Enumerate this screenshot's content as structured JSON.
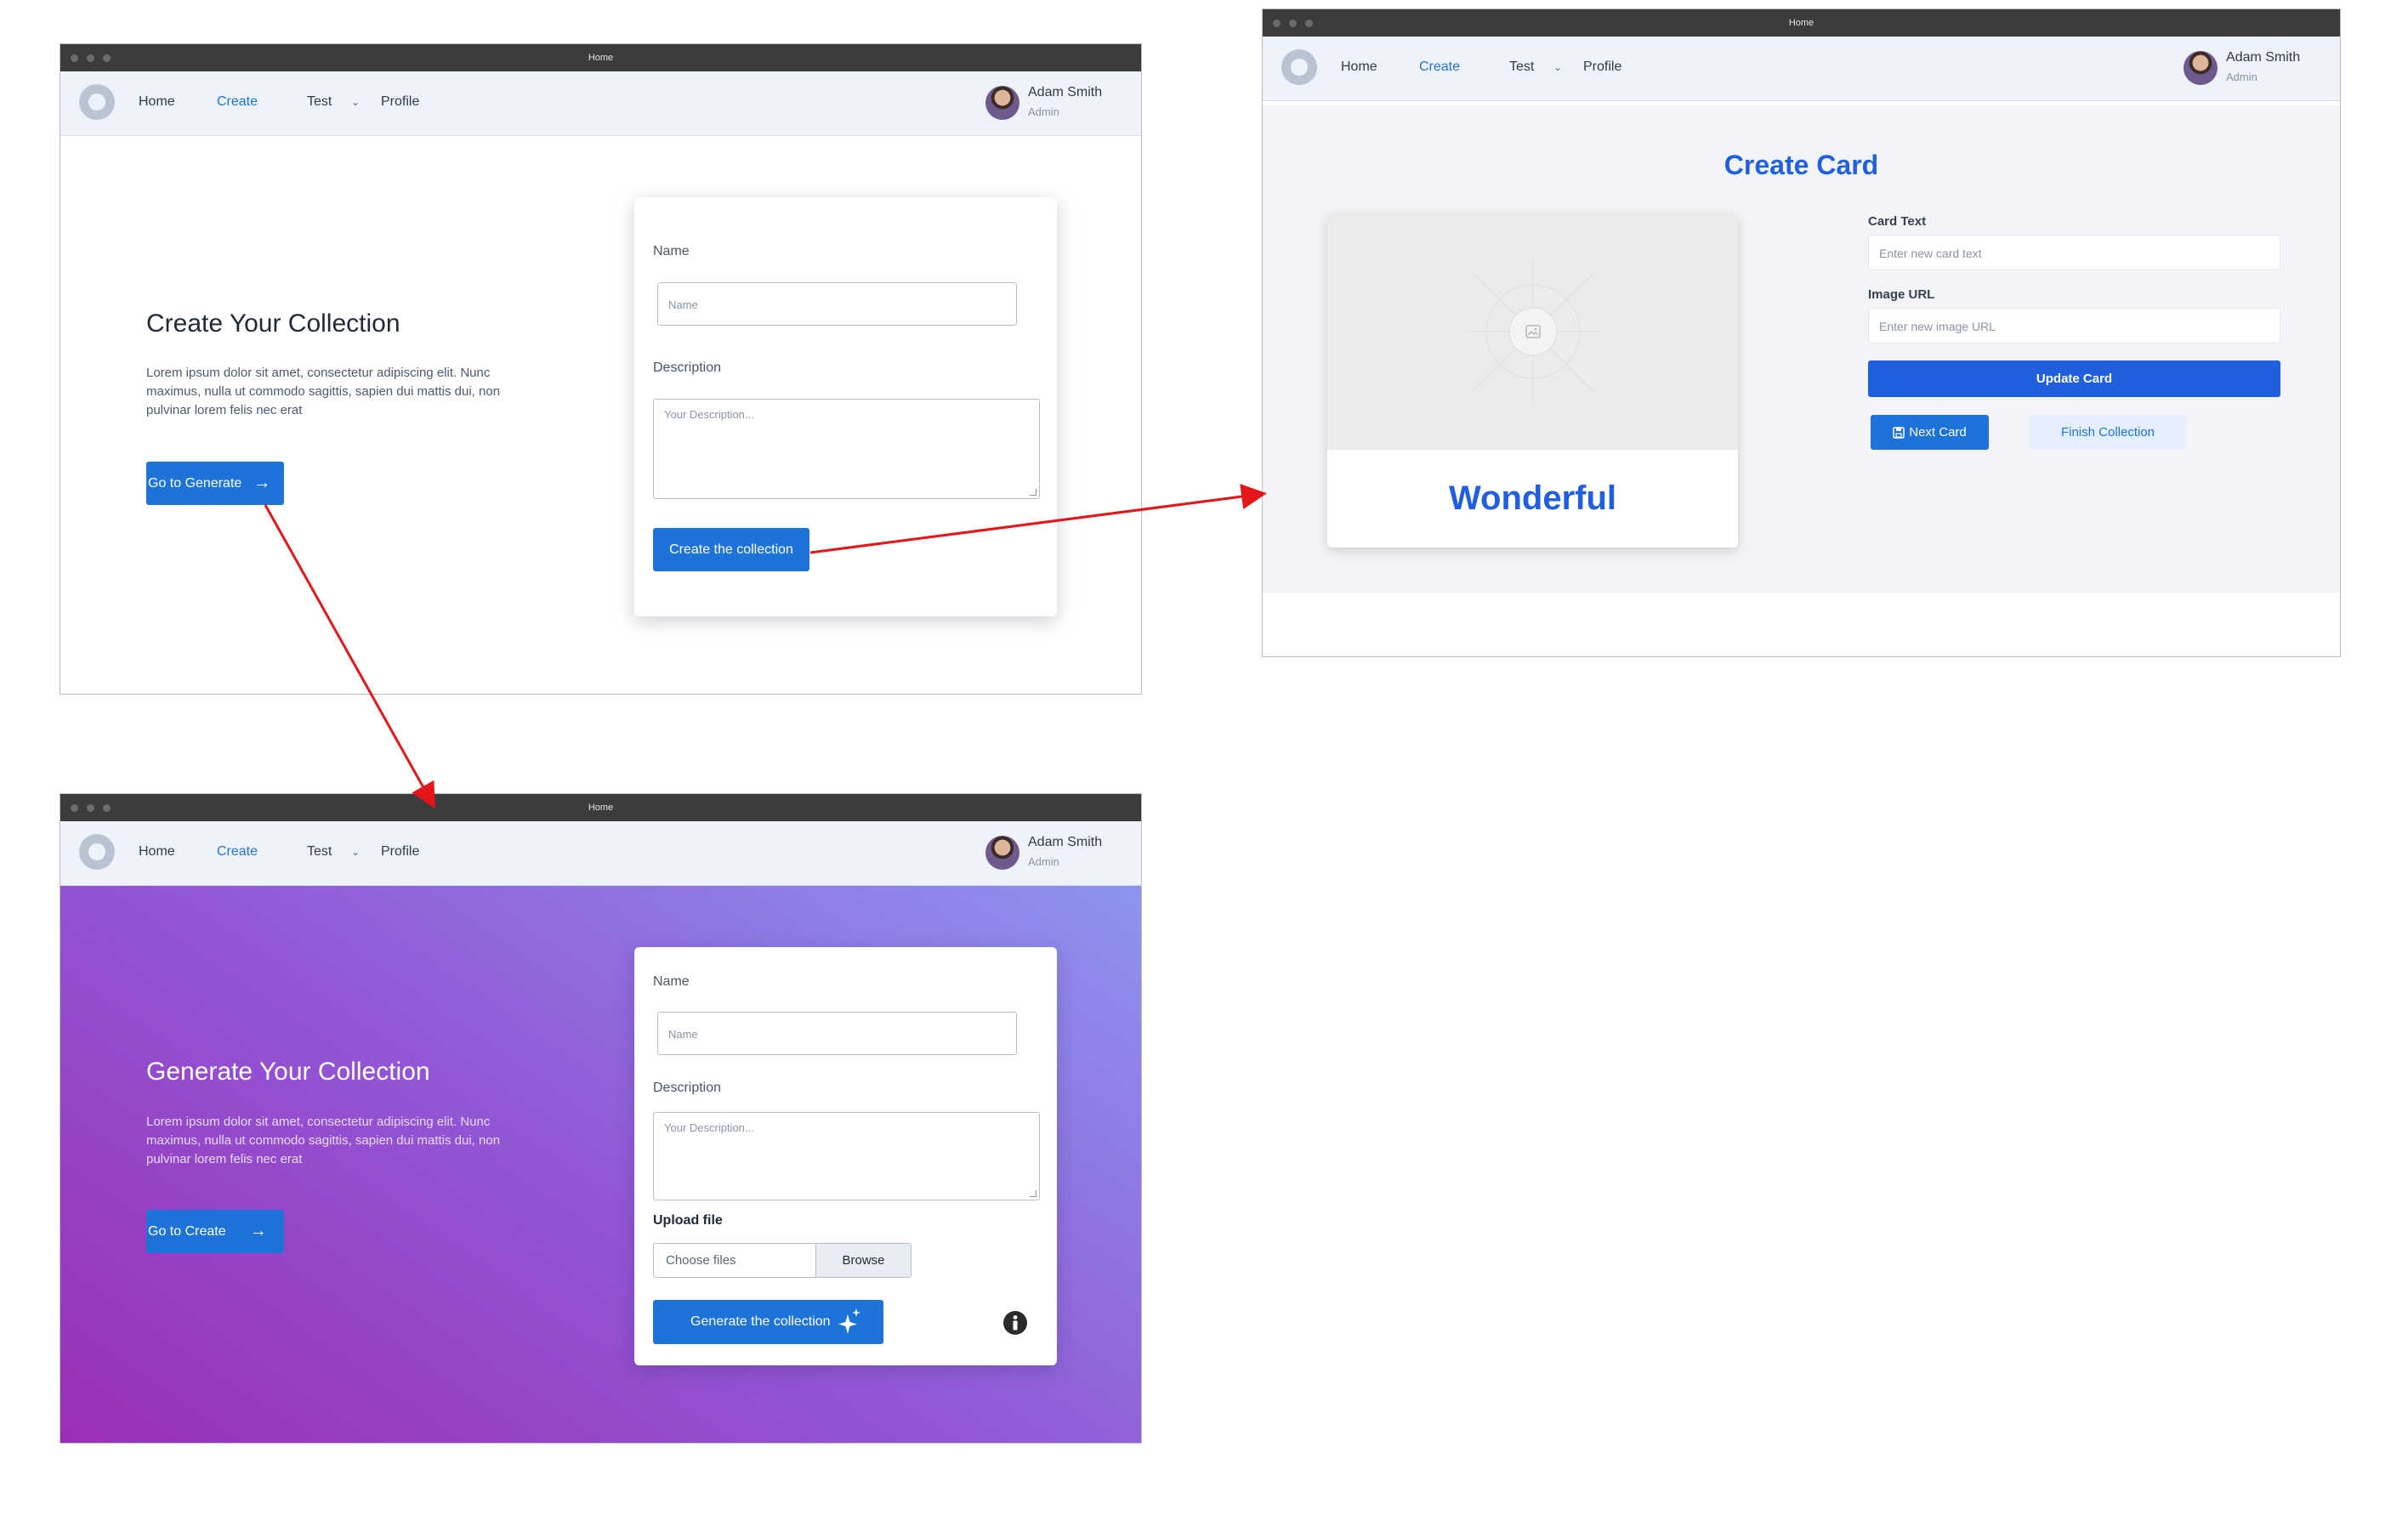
{
  "windows": {
    "create": {
      "title": "Home"
    },
    "generate": {
      "title": "Home"
    },
    "card": {
      "title": "Home"
    }
  },
  "nav": {
    "home": "Home",
    "create": "Create",
    "test": "Test",
    "profile": "Profile",
    "user_name": "Adam Smith",
    "user_role": "Admin"
  },
  "create_page": {
    "heading": "Create Your Collection",
    "lead": "Lorem ipsum dolor sit amet, consectetur adipiscing elit. Nunc maximus, nulla ut commodo sagittis, sapien dui mattis dui, non pulvinar lorem felis nec erat",
    "goto_button": "Go to Generate",
    "form": {
      "name_label": "Name",
      "name_placeholder": "Name",
      "description_label": "Description",
      "description_placeholder": "Your Description...",
      "submit": "Create the collection"
    }
  },
  "generate_page": {
    "heading": "Generate Your Collection",
    "lead": "Lorem ipsum dolor sit amet, consectetur adipiscing elit. Nunc maximus, nulla ut commodo sagittis, sapien dui mattis dui, non pulvinar lorem felis nec erat",
    "goto_button": "Go to Create",
    "form": {
      "name_label": "Name",
      "name_placeholder": "Name",
      "description_label": "Description",
      "description_placeholder": "Your Description...",
      "upload_label": "Upload file",
      "file_placeholder": "Choose files",
      "browse": "Browse",
      "submit": "Generate the collection"
    }
  },
  "card_page": {
    "heading": "Create Card",
    "card_caption": "Wonderful",
    "card_text_label": "Card Text",
    "card_text_placeholder": "Enter new card text",
    "image_url_label": "Image URL",
    "image_url_placeholder": "Enter new image URL",
    "update_button": "Update Card",
    "next_button": "Next Card",
    "finish_button": "Finish Collection"
  },
  "colors": {
    "primary": "#1e73d8",
    "card_primary": "#1f5fe0",
    "gradient_start": "#9a2fb5",
    "gradient_end": "#8c9cf2",
    "arrow": "#e4161a"
  }
}
